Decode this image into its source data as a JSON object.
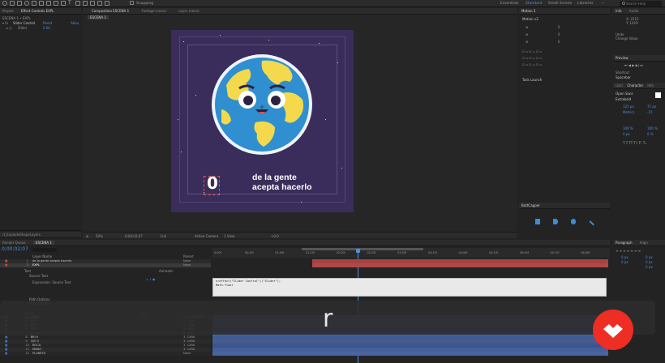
{
  "toolbar": {
    "snapping": "Snapping",
    "workspaces": [
      "Essentials",
      "Standard",
      "Small Screen",
      "Libraries"
    ],
    "active_workspace": "Standard",
    "search_placeholder": "Search Help"
  },
  "project_panel": {
    "tabs": [
      "Project",
      "Effect Controls EXPL"
    ],
    "breadcrumb": "ESCENA 1 • EXPL",
    "effect_name": "Slider Control",
    "reset_label": "Reset",
    "about_label": "Abou",
    "property_label": "Slider",
    "property_value": "0.00",
    "footer_label": "rt_ExplodeShapeLayers"
  },
  "viewer": {
    "tabs": [
      "Composition ESCENA 1",
      "Footage (none)",
      "Layer (none)"
    ],
    "comp_tab": "ESCENA 1",
    "counter": "0",
    "caption_line1": "de la gente",
    "caption_line2": "acepta hacerlo",
    "zoom": "50%",
    "timecode": "0;00;02;07",
    "resolution": "Full",
    "camera": "Active Camera",
    "view": "1 View",
    "offset": "+0.0"
  },
  "motion_panel": {
    "title": "Motion 2",
    "preset": "Motion v2",
    "task": "Task Launch",
    "values": [
      "0",
      "0",
      "0"
    ]
  },
  "buttcapper": {
    "title": "ButtCapper"
  },
  "right_panels": {
    "info_tabs": [
      "Info",
      "Audio"
    ],
    "info_x": "X: 2215",
    "info_y": "Y: 1419",
    "undo_label": "Undo",
    "undo_action": "Change Value",
    "preview_title": "Preview",
    "shortcut_label": "Shortcut",
    "shortcut_value": "Spacebar",
    "character_tabs": [
      "Librr",
      "Character",
      "Info"
    ],
    "font_family": "Open Sans",
    "font_style": "Extrabold",
    "font_size": "125 px",
    "leading": "71 px",
    "kerning": "Metrics",
    "tracking": "-15",
    "vscale": "100 %",
    "hscale": "100 %",
    "baseline": "0 px",
    "tsume": "0 %",
    "paragraph_tabs": [
      "Paragraph",
      "Align"
    ],
    "indent_values": [
      "0 px",
      "0 px",
      "0 px",
      "0 px",
      "0 px"
    ]
  },
  "timeline": {
    "tabs": [
      "Render Queue",
      "ESCENA 1"
    ],
    "timecode": "0;00;02;07",
    "header_layer_name": "Layer Name",
    "header_parent": "Parent",
    "layers": [
      {
        "num": "1",
        "name": "de la gente acepta hacerlo",
        "parent": "None"
      },
      {
        "num": "2",
        "name": "EXPL",
        "parent": "None"
      }
    ],
    "text_group": "Text",
    "source_text": "Source Text",
    "expression_label": "Expression: Source Text",
    "expression_code_line1": "n=effect(\"Slider Control\")(\"Slider\");",
    "expression_code_line2": "Math.floor",
    "animate_label": "Animate:",
    "sub_items": [
      "Path Options",
      "More Options",
      "Effects",
      "Transform"
    ],
    "reset_label": "Reset",
    "lower_layers": [
      {
        "num": "3",
        "name": "CARA",
        "parent": "11. PLANETA"
      },
      {
        "num": "4",
        "name": "OJO I",
        "parent": "3. CARA"
      },
      {
        "num": "5",
        "name": "BRI I",
        "parent": "3. CARA"
      },
      {
        "num": "6",
        "name": "OJO I",
        "parent": "3. CARA"
      },
      {
        "num": "7",
        "name": "OJO II",
        "parent": "3. CARA"
      },
      {
        "num": "8",
        "name": "BRI II",
        "parent": "3. CARA"
      },
      {
        "num": "9",
        "name": "OJO II",
        "parent": "3. CARA"
      },
      {
        "num": "10",
        "name": "BOCA",
        "parent": "3. CARA"
      },
      {
        "num": "11",
        "name": "MANO",
        "parent": "3. CARA"
      },
      {
        "num": "12",
        "name": "PLANETA",
        "parent": "None"
      }
    ],
    "ruler_labels": [
      "0:00f",
      "00:15f",
      "01:00f",
      "01:15f",
      "02:00f",
      "02:15f",
      "03:00f",
      "03:15f",
      "04:00f",
      "04:15f",
      "05:00f",
      "05:15f",
      "06:00f"
    ]
  },
  "overlay": {
    "text": "r"
  },
  "colors": {
    "accent": "#4d8fe0",
    "comp_bg": "#3a2d5b",
    "ocean": "#2f8fd0",
    "land": "#f3d94b",
    "layer_red": "#a84242",
    "layer_blue": "#3f5b96",
    "logo": "#ee2d24"
  }
}
